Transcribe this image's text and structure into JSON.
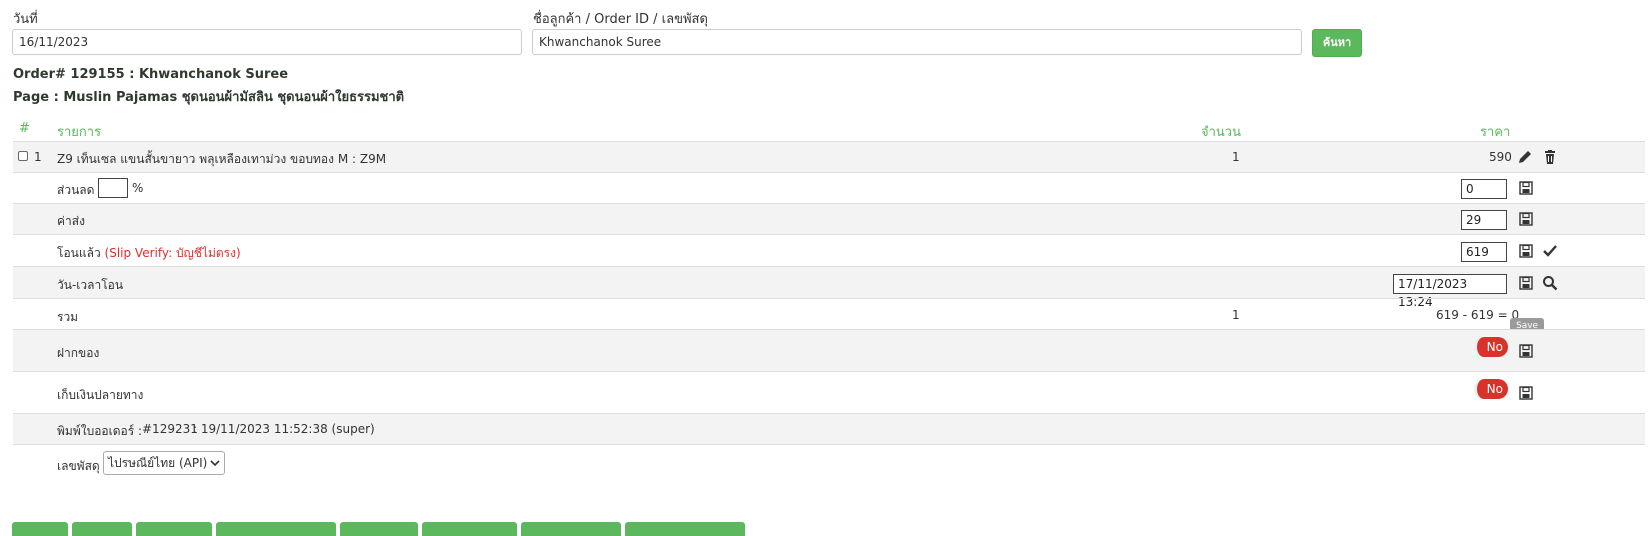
{
  "search": {
    "date_label": "วันที่",
    "date_value": "16/11/2023",
    "customer_label": "ชื่อลูกค้า / Order ID / เลขพัสดุ",
    "customer_value": "Khwanchanok Suree",
    "search_button": "ค้นหา"
  },
  "order": {
    "title": "Order# 129155 : Khwanchanok Suree",
    "page": "Page : Muslin Pajamas ชุดนอนผ้ามัสลิน ชุดนอนผ้าใยธรรมชาติ"
  },
  "table": {
    "col_hash": "#",
    "col_item": "รายการ",
    "col_qty": "จำนวน",
    "col_price": "ราคา"
  },
  "item": {
    "index": "1",
    "name": "Z9 เท็นเซล แขนสั้นขายาว พลุเหลืองเทาม่วง ขอบทอง M : Z9M",
    "qty": "1",
    "price": "590"
  },
  "discount": {
    "label": "ส่วนลด",
    "percent_sign": "%",
    "percent_value": "",
    "value": "0"
  },
  "shipping": {
    "label": "ค่าส่ง",
    "value": "29"
  },
  "transfer": {
    "label": "โอนแล้ว",
    "note": "(Slip Verify: บัญชีไม่ตรง)",
    "value": "619"
  },
  "transfer_time": {
    "label": "วัน-เวลาโอน",
    "value": "17/11/2023 13:24"
  },
  "total": {
    "label": "รวม",
    "qty": "1",
    "text": "619 - 619 = 0"
  },
  "deposit": {
    "label": "ฝากของ",
    "toggle": "No",
    "tooltip": "Save"
  },
  "cod": {
    "label": "เก็บเงินปลายทาง",
    "toggle": "No"
  },
  "print": {
    "label": "พิมพ์ใบออเดอร์ :",
    "link": "#129231",
    "detail": ": 19/11/2023 11:52:38 (super)"
  },
  "tracking": {
    "label": "เลขพัสดุ",
    "carrier": "ไปรษณีย์ไทย (API)"
  },
  "colors": {
    "accent": "#5cb85c",
    "danger": "#d9322b",
    "link": "#3a7ab7"
  },
  "icons": [
    "pencil-icon",
    "trash-icon",
    "floppy-disk-icon",
    "check-icon",
    "search-icon",
    "chevron-down-icon"
  ]
}
